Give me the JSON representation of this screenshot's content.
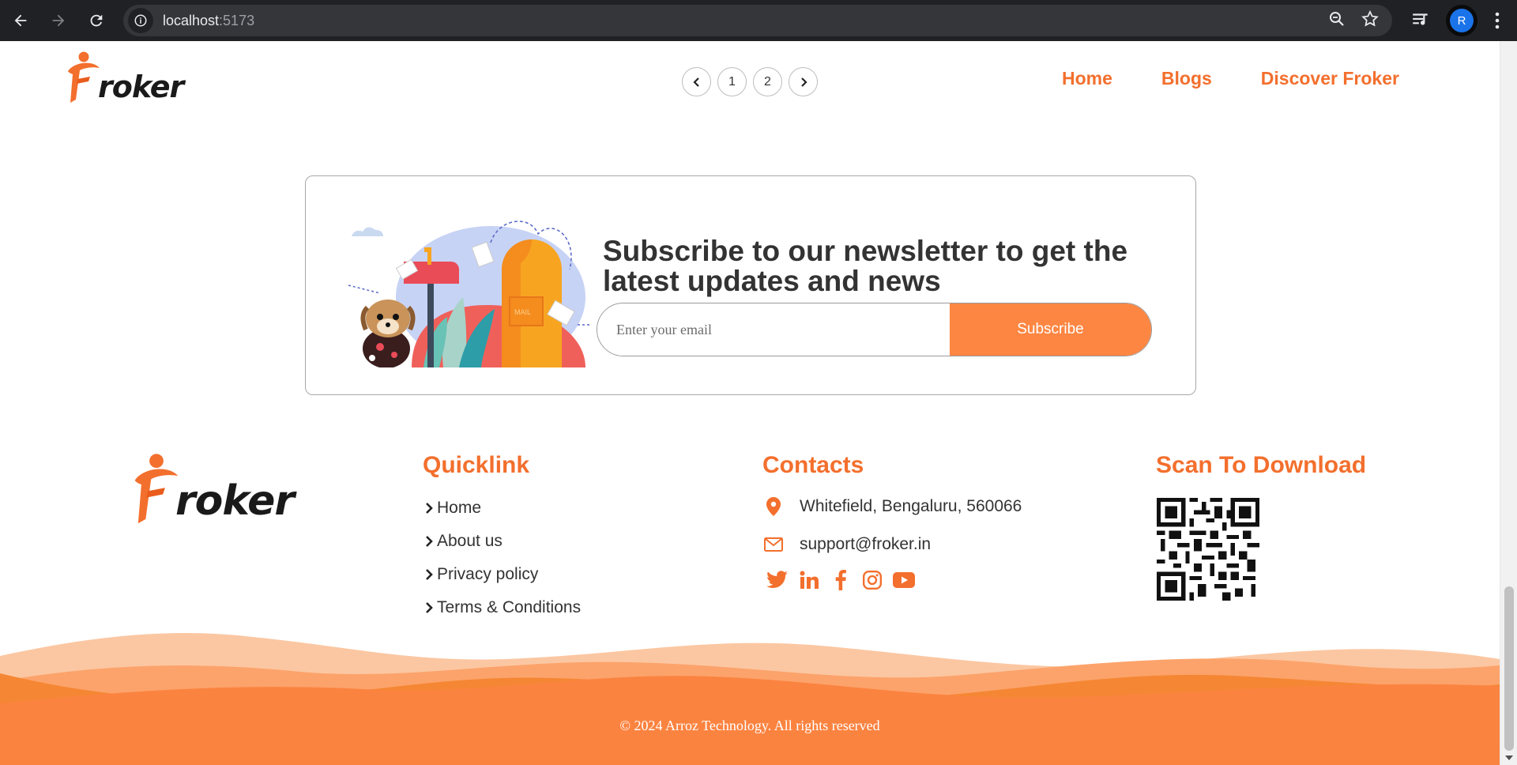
{
  "browser": {
    "url_host": "localhost",
    "url_port": ":5173",
    "profile_initial": "R"
  },
  "header": {
    "logo_text": "roker",
    "pagination": {
      "pages": [
        "1",
        "2"
      ]
    },
    "nav": [
      "Home",
      "Blogs",
      "Discover Froker"
    ]
  },
  "newsletter": {
    "heading": "Subscribe to our newsletter to get the latest updates and news",
    "email_placeholder": "Enter your email",
    "subscribe_label": "Subscribe",
    "mailbox_label": "MAIL"
  },
  "footer": {
    "logo_text": "roker",
    "quicklink": {
      "title": "Quicklink",
      "items": [
        "Home",
        "About us",
        "Privacy policy",
        "Terms & Conditions"
      ]
    },
    "contacts": {
      "title": "Contacts",
      "address": "Whitefield, Bengaluru, 560066",
      "email": "support@froker.in",
      "socials": [
        "twitter-icon",
        "linkedin-icon",
        "facebook-icon",
        "instagram-icon",
        "youtube-icon"
      ]
    },
    "download": {
      "title": "Scan To Download"
    },
    "copyright": "© 2024 Arroz Technology. All rights reserved"
  },
  "colors": {
    "brand_orange": "#f36f2d",
    "button_orange": "#fd8642",
    "wave_dark": "#f97a30",
    "wave_light": "#fbc7a2"
  }
}
